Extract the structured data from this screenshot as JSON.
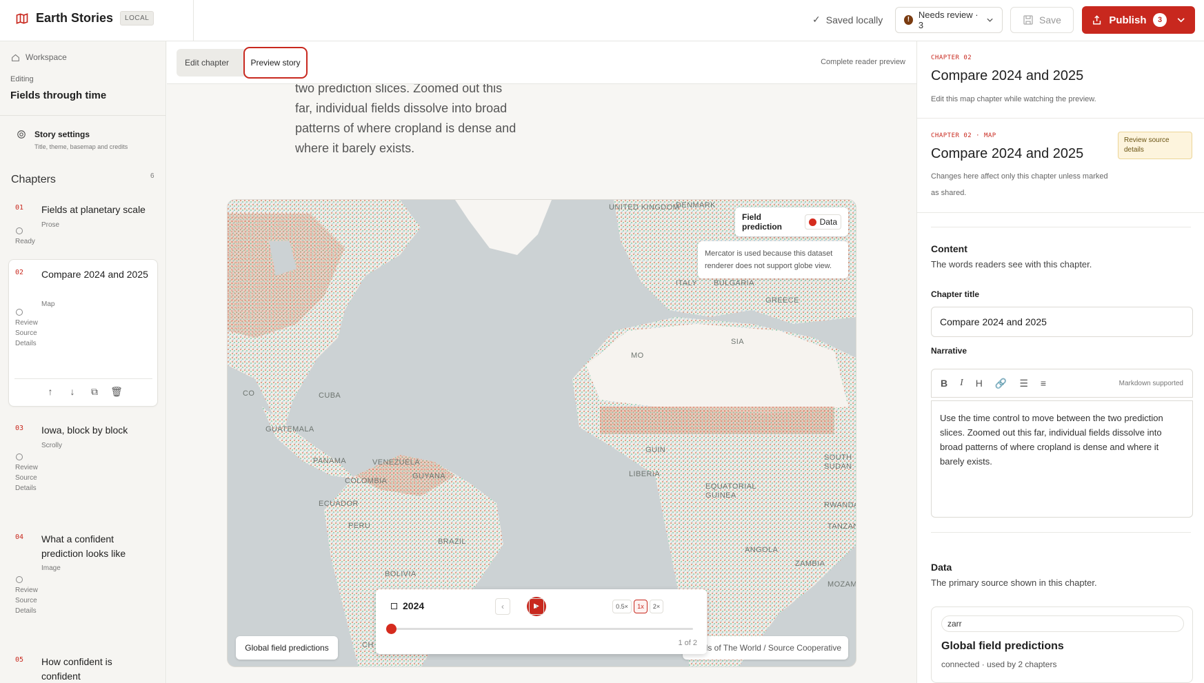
{
  "app": {
    "title": "Earth Stories",
    "mode_badge": "LOCAL",
    "saved_status": "Saved locally",
    "needs_review": "Needs review · 3",
    "save_label": "Save",
    "publish_label": "Publish",
    "publish_count": "3"
  },
  "sidebar": {
    "workspace": "Workspace",
    "editing_label": "Editing",
    "story_name": "Fields through time",
    "settings_title": "Story settings",
    "settings_sub": "Title, theme, basemap and credits",
    "chapters_heading": "Chapters",
    "chapters_count": "6",
    "chapters": [
      {
        "num": "01",
        "name": "Fields at planetary scale",
        "kind": "Prose",
        "status": "Ready"
      },
      {
        "num": "02",
        "name": "Compare 2024 and 2025",
        "kind": "Map",
        "status": "Review Source Details"
      },
      {
        "num": "03",
        "name": "Iowa, block by block",
        "kind": "Scrolly",
        "status": "Review Source Details"
      },
      {
        "num": "04",
        "name": "What a confident prediction looks like",
        "kind": "Image",
        "status": "Review Source Details"
      },
      {
        "num": "05",
        "name": "How confident is confident",
        "kind": "",
        "status": ""
      }
    ]
  },
  "preview": {
    "tab_edit": "Edit chapter",
    "tab_preview": "Preview story",
    "complete_label": "Complete reader preview",
    "narrative": "two prediction slices. Zoomed out this far, individual fields dissolve into broad patterns of where cropland is dense and where it barely exists.",
    "map": {
      "legend_title": "Field prediction",
      "legend_item": "Data",
      "projection_note": "Mercator is used because this dataset renderer does not support globe view.",
      "dataset_name": "Global field predictions",
      "attribution": "Fields of The World / Source Cooperative",
      "labels": [
        "UNITED KINGDOM",
        "DENMARK",
        "ITALY",
        "BULGARIA",
        "GREECE",
        "CUBA",
        "GUATEMALA",
        "PANAMA",
        "VENEZUELA",
        "GUYANA",
        "COLOMBIA",
        "ECUADOR",
        "PERU",
        "BRAZIL",
        "BOLIVIA",
        "LIBERIA",
        "EQUATORIAL GUINEA",
        "RWANDA",
        "TANZANIA",
        "ANGOLA",
        "ZAMBIA",
        "MOZAMBIQUE",
        "SOUTH SUDAN",
        "SIA",
        "MO",
        "CO",
        "GUIN",
        "CH"
      ],
      "time": {
        "year": "2024",
        "speeds": [
          "0.5×",
          "1x",
          "2×"
        ],
        "active_speed": "1x",
        "position": "1 of 2"
      }
    }
  },
  "panel": {
    "chapter_kicker": "CHAPTER 02",
    "chapter_title": "Compare 2024 and 2025",
    "chapter_sub": "Edit this map chapter while watching the preview.",
    "map_kicker": "CHAPTER 02 · MAP",
    "map_title": "Compare 2024 and 2025",
    "map_sub": "Changes here affect only this chapter unless marked as shared.",
    "review_pill": "Review source details",
    "content_heading": "Content",
    "content_desc": "The words readers see with this chapter.",
    "title_label": "Chapter title",
    "title_value": "Compare 2024 and 2025",
    "narrative_label": "Narrative",
    "markdown_note": "Markdown supported",
    "narrative_value": "Use the time control to move between the two prediction slices. Zoomed out this far, individual fields dissolve into broad patterns of where cropland is dense and where it barely exists.",
    "data_heading": "Data",
    "data_desc": "The primary source shown in this chapter.",
    "data_format": "zarr",
    "data_name": "Global field predictions",
    "data_meta": "connected · used by 2 chapters"
  },
  "colors": {
    "accent": "#c8281e",
    "ocean": "#ccd2d4",
    "land": "#f5f3ef"
  }
}
